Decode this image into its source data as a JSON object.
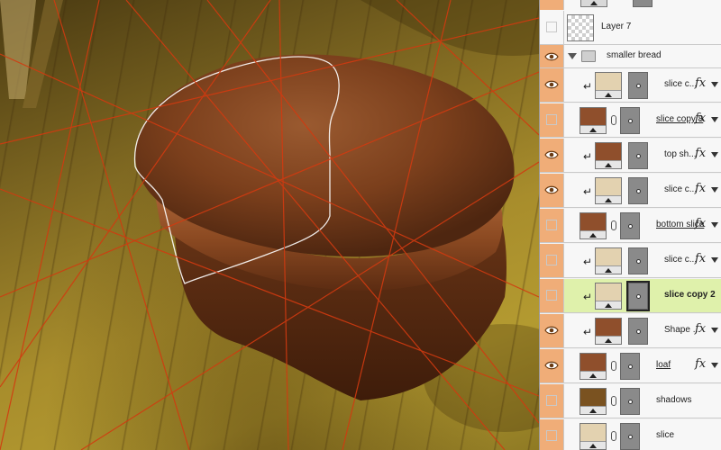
{
  "canvas": {
    "colors": {
      "bread_dark": "#5a2e12",
      "bread_mid": "#8a4a25",
      "bread_light": "#a6643a",
      "guide_line": "#d23a10",
      "selection": "#ffffff"
    }
  },
  "layers_panel": {
    "group_name": "smaller bread",
    "layers": [
      {
        "name": "Layer 7",
        "visible": false,
        "thumb_color": "#cfcfcf",
        "checker": true,
        "type": "plain",
        "underline": false,
        "fx": false,
        "clipped": false,
        "selected": false
      },
      {
        "name": "slice c...",
        "visible": true,
        "thumb_color": "#e3d2b0",
        "type": "masked",
        "underline": false,
        "fx": true,
        "clipped": true,
        "selected": false
      },
      {
        "name": "slice copy 8",
        "visible": false,
        "thumb_color": "#8f4f2c",
        "type": "linked",
        "underline": true,
        "fx": true,
        "clipped": false,
        "selected": false
      },
      {
        "name": "top sh...",
        "visible": true,
        "thumb_color": "#8f4f2c",
        "type": "masked",
        "underline": false,
        "fx": true,
        "clipped": true,
        "selected": false
      },
      {
        "name": "slice c...",
        "visible": true,
        "thumb_color": "#e3d2b0",
        "type": "masked",
        "underline": false,
        "fx": true,
        "clipped": true,
        "selected": false
      },
      {
        "name": "bottom slice",
        "visible": false,
        "thumb_color": "#8f4f2c",
        "type": "linked",
        "underline": true,
        "fx": true,
        "clipped": false,
        "selected": false
      },
      {
        "name": "slice c...",
        "visible": false,
        "thumb_color": "#e3d2b0",
        "type": "masked",
        "underline": false,
        "fx": true,
        "clipped": true,
        "selected": false
      },
      {
        "name": "slice copy 2",
        "visible": false,
        "thumb_color": "#e3d2b0",
        "type": "masked",
        "underline": false,
        "fx": false,
        "clipped": true,
        "selected": true
      },
      {
        "name": "Shape ...",
        "visible": true,
        "thumb_color": "#8f4f2c",
        "type": "masked",
        "underline": false,
        "fx": true,
        "clipped": true,
        "selected": false
      },
      {
        "name": "loaf",
        "visible": true,
        "thumb_color": "#8f4f2c",
        "type": "linked",
        "underline": true,
        "fx": true,
        "clipped": false,
        "selected": false
      },
      {
        "name": "shadows",
        "visible": false,
        "thumb_color": "#7a5220",
        "type": "linked",
        "underline": false,
        "fx": false,
        "clipped": false,
        "selected": false
      },
      {
        "name": "slice",
        "visible": false,
        "thumb_color": "#e3d2b0",
        "type": "linked",
        "underline": false,
        "fx": false,
        "clipped": false,
        "selected": false
      }
    ]
  }
}
